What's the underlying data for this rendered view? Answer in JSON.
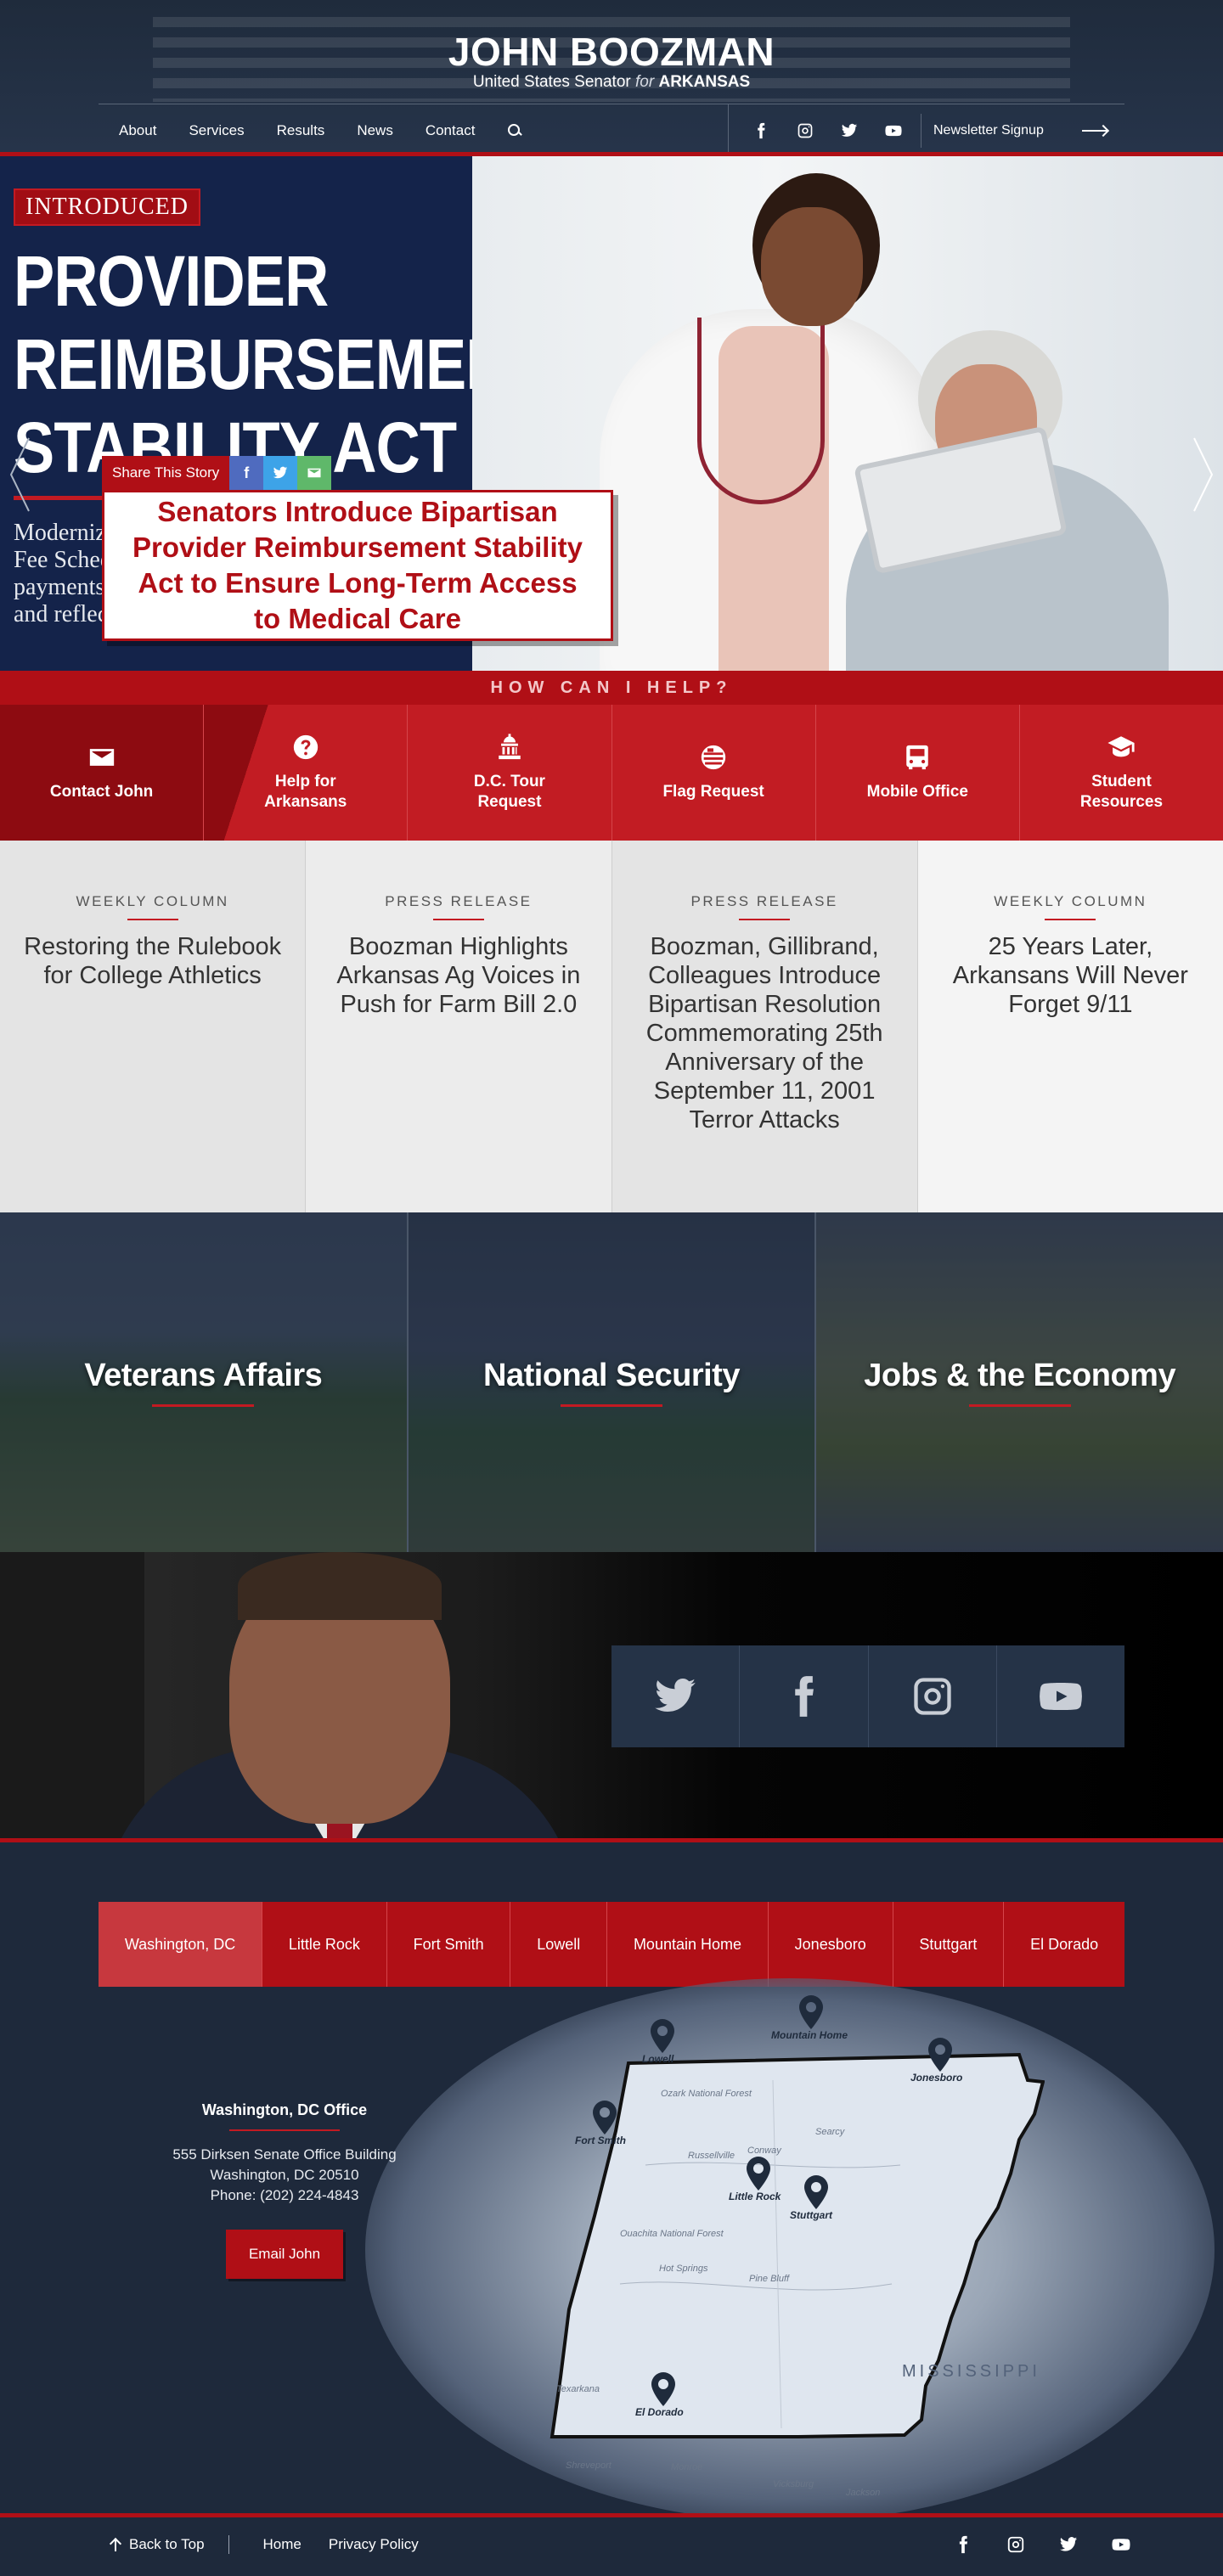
{
  "header": {
    "name": "JOHN BOOZMAN",
    "subtitle_pre": "United States Senator",
    "subtitle_for": "for",
    "subtitle_state": "ARKANSAS",
    "nav": [
      "About",
      "Services",
      "Results",
      "News",
      "Contact"
    ],
    "newsletter": "Newsletter Signup"
  },
  "hero": {
    "tag": "INTRODUCED",
    "title_lines": [
      "PROVIDER",
      "REIMBURSEMENT",
      "STABILITY ACT"
    ],
    "description_lines": [
      "Modernize the Medicare Physician",
      "Fee Schedule to stabilize",
      "payments for physicians",
      "and reflect the cost of care"
    ],
    "share_label": "Share This Story",
    "card_title": "Senators Introduce Bipartisan Provider Reimbursement Stability Act to Ensure Long-Term Access to Medical Care"
  },
  "help": {
    "title": "HOW CAN I HELP?",
    "items": [
      {
        "label": "Contact John",
        "icon": "envelope-icon"
      },
      {
        "label": "Help for Arkansans",
        "icon": "question-icon"
      },
      {
        "label": "D.C. Tour Request",
        "icon": "capitol-icon"
      },
      {
        "label": "Flag Request",
        "icon": "flag-icon"
      },
      {
        "label": "Mobile Office",
        "icon": "bus-icon"
      },
      {
        "label": "Student Resources",
        "icon": "graduation-cap-icon"
      }
    ]
  },
  "news": [
    {
      "type": "WEEKLY COLUMN",
      "title": "Restoring the Rulebook for College Athletics"
    },
    {
      "type": "PRESS RELEASE",
      "title": "Boozman Highlights Arkansas Ag Voices in Push for Farm Bill 2.0"
    },
    {
      "type": "PRESS RELEASE",
      "title": "Boozman, Gillibrand, Colleagues Introduce Bipartisan Resolution Commemorating 25th Anniversary of the September 11, 2001 Terror Attacks"
    },
    {
      "type": "WEEKLY COLUMN",
      "title": "25 Years Later, Arkansans Will Never Forget 9/11"
    }
  ],
  "issues": [
    "Veterans Affairs",
    "National Security",
    "Jobs & the Economy"
  ],
  "offices": {
    "tabs": [
      "Washington, DC",
      "Little Rock",
      "Fort Smith",
      "Lowell",
      "Mountain Home",
      "Jonesboro",
      "Stuttgart",
      "El Dorado"
    ],
    "active": {
      "name": "Washington, DC Office",
      "address1": "555 Dirksen Senate Office Building",
      "address2": "Washington, DC 20510",
      "phone": "Phone: (202) 224-4843",
      "email_button": "Email John"
    },
    "map_pins": [
      "Lowell",
      "Mountain Home",
      "Jonesboro",
      "Fort Smith",
      "Little Rock",
      "Stuttgart",
      "El Dorado"
    ],
    "map_labels": [
      "Ozark National Forest",
      "Ouachita National Forest",
      "Russellville",
      "Conway",
      "Searcy",
      "Hot Springs",
      "Pine Bluff",
      "Texarkana",
      "Monroe",
      "Vicksburg",
      "Jackson",
      "Shreveport"
    ],
    "state_label": "MISSISSIPPI"
  },
  "footer": {
    "back_to_top": "Back to Top",
    "links": [
      "Home",
      "Privacy Policy"
    ]
  },
  "colors": {
    "brand_red": "#b00f16",
    "navy": "#1e293b"
  }
}
